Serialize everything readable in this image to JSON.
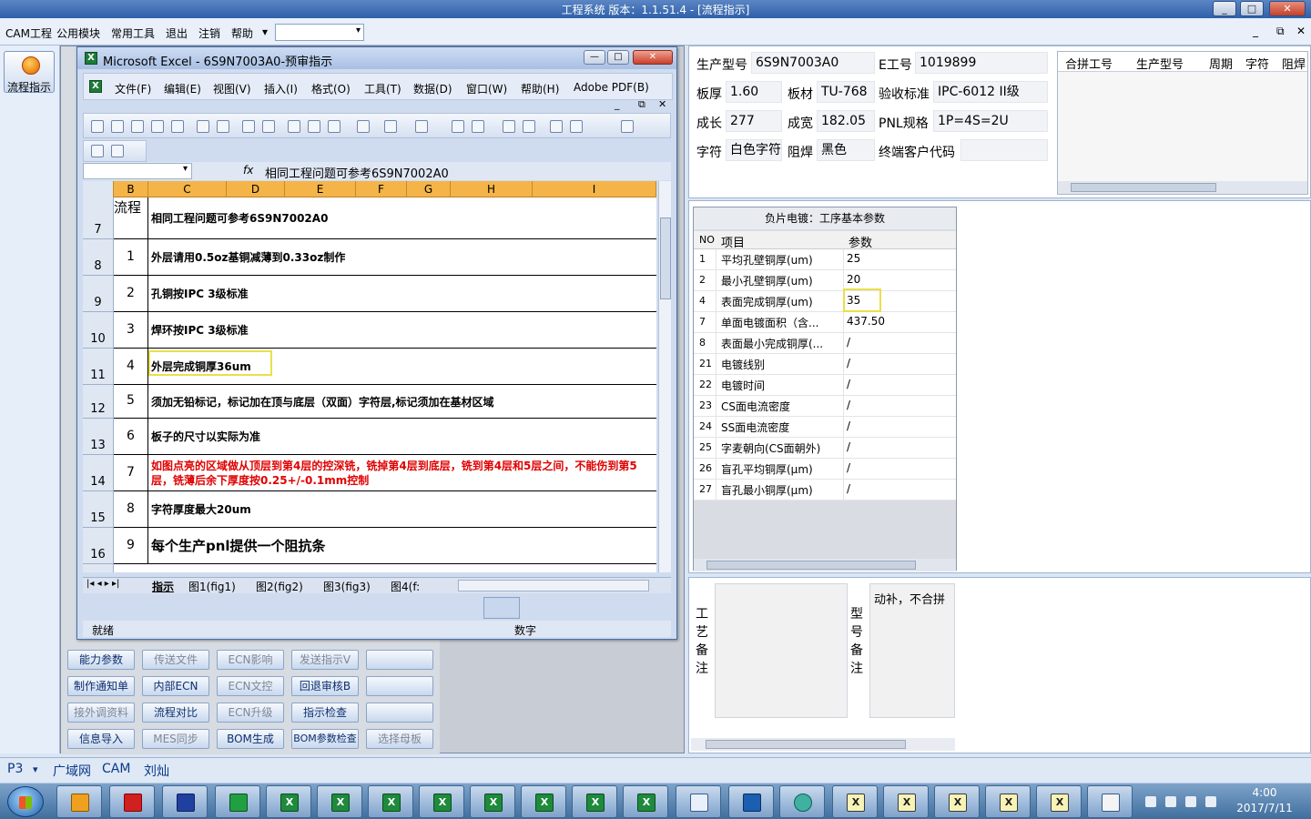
{
  "app": {
    "title": "工程系统   版本：1.1.51.4 - [流程指示]",
    "window_controls": [
      "_",
      "□",
      "✕"
    ],
    "menu": [
      "CAM工程",
      "公用模块",
      "常用工具",
      "退出",
      "注销",
      "帮助"
    ],
    "menu_help_arrow": "▾",
    "mdi_controls": [
      "_",
      "⧉",
      "✕"
    ]
  },
  "left_toolbar": {
    "flow_button": "流程指示"
  },
  "mid_buttons": [
    {
      "label": "能力参数",
      "enabled": true
    },
    {
      "label": "传送文件",
      "enabled": false
    },
    {
      "label": "ECN影响",
      "enabled": false
    },
    {
      "label": "发送指示V",
      "enabled": false
    },
    {
      "label": "",
      "enabled": true
    },
    {
      "label": "制作通知单",
      "enabled": true
    },
    {
      "label": "内部ECN",
      "enabled": true
    },
    {
      "label": "ECN文控",
      "enabled": false
    },
    {
      "label": "回退审核B",
      "enabled": true
    },
    {
      "label": "",
      "enabled": true
    },
    {
      "label": "接外调资料",
      "enabled": false
    },
    {
      "label": "流程对比",
      "enabled": true
    },
    {
      "label": "ECN升级",
      "enabled": false
    },
    {
      "label": "指示检查",
      "enabled": true
    },
    {
      "label": "",
      "enabled": true
    },
    {
      "label": "信息导入",
      "enabled": true
    },
    {
      "label": "MES同步",
      "enabled": false
    },
    {
      "label": "BOM生成",
      "enabled": true
    },
    {
      "label": "BOM参数检查",
      "enabled": true
    },
    {
      "label": "选择母板",
      "enabled": false
    }
  ],
  "excel": {
    "title": "Microsoft Excel - 6S9N7003A0-预审指示",
    "controls": [
      "—",
      "□",
      "✕"
    ],
    "menu": [
      "文件(F)",
      "编辑(E)",
      "视图(V)",
      "插入(I)",
      "格式(O)",
      "工具(T)",
      "数据(D)",
      "窗口(W)",
      "帮助(H)",
      "Adobe PDF(B)"
    ],
    "menu_controls": [
      "_",
      "⧉",
      "✕"
    ],
    "fx": "fx",
    "formula": "相同工程问题可参考6S9N7002A0",
    "columns": [
      "B",
      "C",
      "D",
      "E",
      "F",
      "G",
      "H",
      "I"
    ],
    "rows": [
      {
        "row": "7",
        "b": "流程",
        "text": "相同工程问题可参考6S9N7002A0",
        "red": false,
        "big": false
      },
      {
        "row": "8",
        "b": "1",
        "text": "外层请用0.5oz基铜减薄到0.33oz制作",
        "red": false,
        "big": false
      },
      {
        "row": "9",
        "b": "2",
        "text": "孔铜按IPC  3级标准",
        "red": false,
        "big": false
      },
      {
        "row": "10",
        "b": "3",
        "text": "焊环按IPC  3级标准",
        "red": false,
        "big": false
      },
      {
        "row": "11",
        "b": "4",
        "text": "外层完成铜厚36um",
        "red": false,
        "big": false
      },
      {
        "row": "12",
        "b": "5",
        "text": "须加无铅标记，标记加在顶与底层（双面）字符层,标记须加在基材区域",
        "red": false,
        "big": false
      },
      {
        "row": "13",
        "b": "6",
        "text": "板子的尺寸以实际为准",
        "red": false,
        "big": false
      },
      {
        "row": "14",
        "b": "7",
        "text": "如图点亮的区域做从顶层到第4层的控深铣，铣掉第4层到底层，铣到第4层和5层之间，不能伤到第5层，铣薄后余下厚度按0.25+/-0.1mm控制",
        "red": true,
        "big": false
      },
      {
        "row": "15",
        "b": "8",
        "text": "字符厚度最大20um",
        "red": false,
        "big": false
      },
      {
        "row": "16",
        "b": "9",
        "text": "每个生产pnl提供一个阻抗条",
        "red": false,
        "big": true
      }
    ],
    "sheet_nav": "|◂ ◂ ▸ ▸|",
    "sheet_tabs": [
      "指示",
      "图1(fig1)",
      "图2(fig2)",
      "图3(fig3)",
      "图4(f:"
    ],
    "status_left": "就绪",
    "status_right": "数字"
  },
  "info": {
    "fields": [
      {
        "label": "生产型号",
        "value": "6S9N7003A0"
      },
      {
        "label": "E工号",
        "value": "1019899"
      },
      {
        "label": "板厚",
        "value": "1.60"
      },
      {
        "label": "板材",
        "value": "TU-768"
      },
      {
        "label": "验收标准",
        "value": "IPC-6012 II级"
      },
      {
        "label": "成长",
        "value": "277"
      },
      {
        "label": "成宽",
        "value": "182.05"
      },
      {
        "label": "PNL规格",
        "value": "1P=4S=2U"
      },
      {
        "label": "字符",
        "value": "白色字符"
      },
      {
        "label": "阻焊",
        "value": "黑色"
      },
      {
        "label": "终端客户代码",
        "value": ""
      }
    ],
    "merge_headers": [
      "合拼工号",
      "生产型号",
      "周期",
      "字符",
      "阻焊"
    ]
  },
  "plating": {
    "title": "负片电镀：工序基本参数",
    "headers": [
      "NO",
      "项目",
      "参数"
    ],
    "rows": [
      {
        "no": "1",
        "item": "平均孔壁铜厚(um)",
        "val": "25"
      },
      {
        "no": "2",
        "item": "最小孔壁铜厚(um)",
        "val": "20"
      },
      {
        "no": "4",
        "item": "表面完成铜厚(um)",
        "val": "35"
      },
      {
        "no": "7",
        "item": "单面电镀面积（含...",
        "val": "437.50"
      },
      {
        "no": "8",
        "item": "表面最小完成铜厚(...",
        "val": "/"
      },
      {
        "no": "21",
        "item": "电镀线别",
        "val": "/"
      },
      {
        "no": "22",
        "item": "电镀时间",
        "val": "/"
      },
      {
        "no": "23",
        "item": "CS面电流密度",
        "val": "/"
      },
      {
        "no": "24",
        "item": "SS面电流密度",
        "val": "/"
      },
      {
        "no": "25",
        "item": "字麦朝向(CS面朝外)",
        "val": "/"
      },
      {
        "no": "26",
        "item": "盲孔平均铜厚(μm)",
        "val": "/"
      },
      {
        "no": "27",
        "item": "盲孔最小铜厚(μm)",
        "val": "/"
      }
    ]
  },
  "notes": {
    "craft_label": "工艺备注",
    "model_label": "型号备注",
    "model_text": "动补，不合拼"
  },
  "statusbar": [
    "P3",
    "广域网",
    "CAM",
    "刘灿"
  ],
  "statusbar_arrow": "▾",
  "taskbar": {
    "time": "4:00",
    "date": "2017/7/11",
    "apps": [
      "X",
      "X",
      "X",
      "X",
      "X",
      "X",
      "X",
      "X"
    ],
    "yellow_apps": [
      "X",
      "X",
      "X",
      "X",
      "X"
    ]
  }
}
